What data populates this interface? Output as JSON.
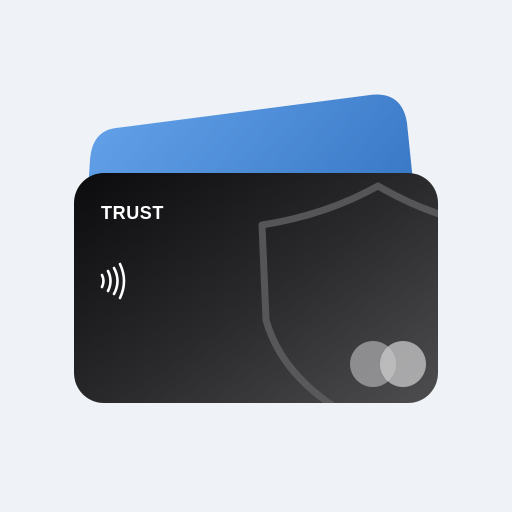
{
  "app": {
    "card_brand": "TRUST"
  },
  "icons": {
    "contactless": "contactless-icon",
    "shield": "shield-icon",
    "card_network": "card-network-logo-icon"
  },
  "colors": {
    "background": "#eff3f7",
    "back_card_start": "#66a4ec",
    "back_card_end": "#3b7ac7",
    "front_card_start": "#0b0b0d",
    "front_card_end": "#4a4a4c",
    "shield_stroke": "#5e5e60",
    "text": "#ffffff"
  }
}
